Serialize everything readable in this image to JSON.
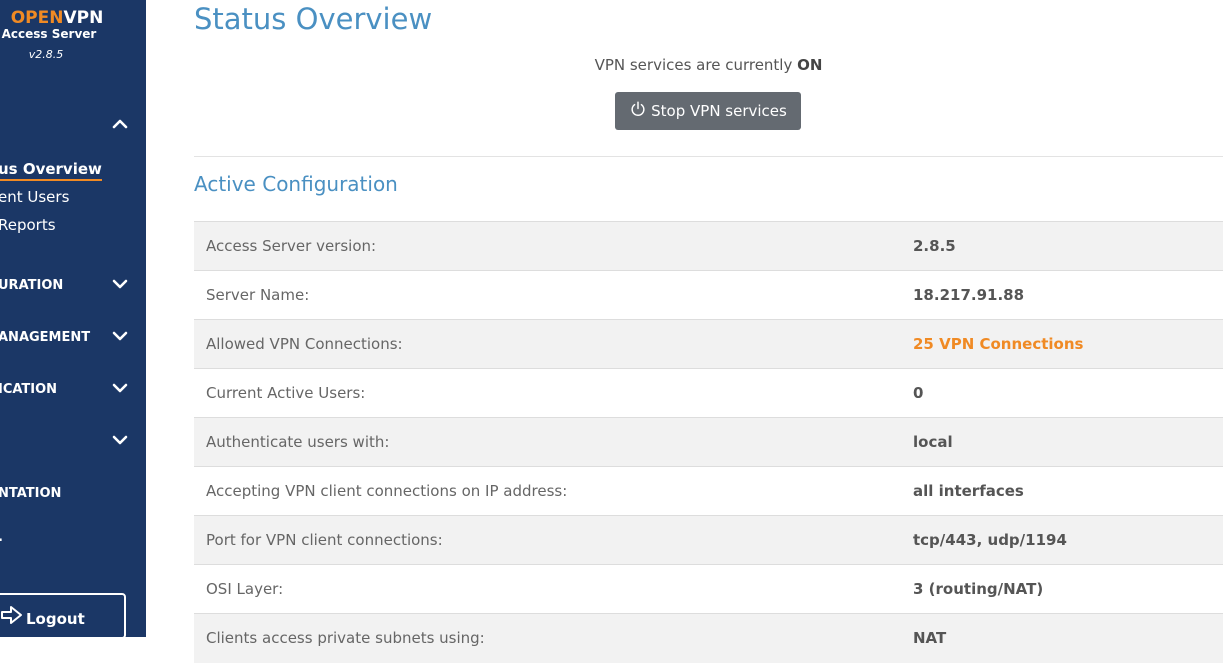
{
  "sidebar": {
    "logo": {
      "brand_open": "OPEN",
      "brand_vpn": "VPN",
      "product": "Access Server",
      "version": "v2.8.5"
    },
    "status_items": [
      {
        "label": "us Overview",
        "active": true
      },
      {
        "label": "ent Users"
      },
      {
        "label": "Reports"
      }
    ],
    "sections": [
      {
        "label": "URATION"
      },
      {
        "label": "ANAGEMENT"
      },
      {
        "label": "ICATION"
      },
      {
        "label": ""
      },
      {
        "label": "NTATION"
      },
      {
        "label": "."
      }
    ],
    "logout_label": "Logout"
  },
  "main": {
    "title": "Status Overview",
    "status_prefix": "VPN services are currently ",
    "status_value": "ON",
    "stop_button_label": "Stop VPN services",
    "section_title": "Active Configuration",
    "rows": [
      {
        "label": "Access Server version:",
        "value": "2.8.5"
      },
      {
        "label": "Server Name:",
        "value": "18.217.91.88"
      },
      {
        "label": "Allowed VPN Connections:",
        "value": "25 VPN Connections"
      },
      {
        "label": "Current Active Users:",
        "value": "0"
      },
      {
        "label": "Authenticate users with:",
        "value": "local"
      },
      {
        "label": "Accepting VPN client connections on IP address:",
        "value": "all interfaces"
      },
      {
        "label": "Port for VPN client connections:",
        "value": "tcp/443, udp/1194"
      },
      {
        "label": "OSI Layer:",
        "value": "3 (routing/NAT)"
      },
      {
        "label": "Clients access private subnets using:",
        "value": "NAT"
      }
    ]
  },
  "colors": {
    "sidebar_bg": "#1b3766",
    "accent": "#f08a24",
    "heading": "#4a90c2",
    "button": "#646a71"
  },
  "icons": {
    "collapse": "chevron-up-icon",
    "expand": "chevron-down-icon",
    "power": "power-icon",
    "logout": "logout-arrow-icon"
  }
}
